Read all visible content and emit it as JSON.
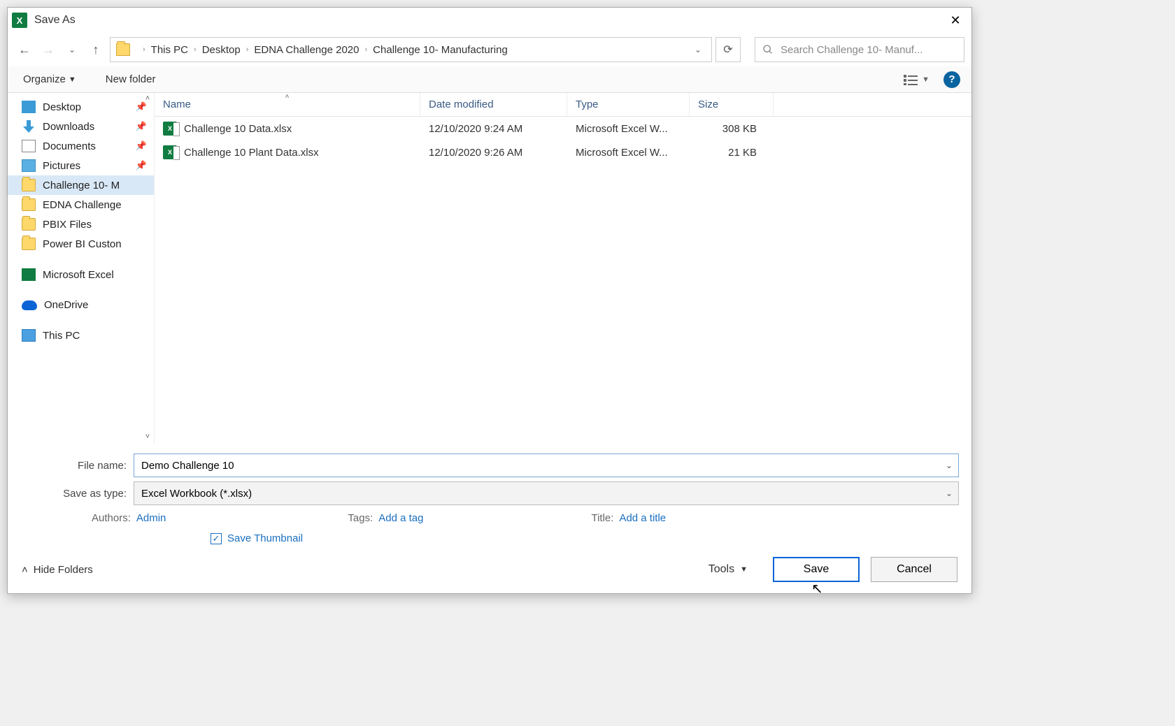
{
  "dialog": {
    "title": "Save As"
  },
  "nav": {
    "breadcrumb": [
      "This PC",
      "Desktop",
      "EDNA Challenge 2020",
      "Challenge 10- Manufacturing"
    ],
    "search_placeholder": "Search Challenge 10- Manuf..."
  },
  "toolbar": {
    "organize": "Organize",
    "newfolder": "New folder"
  },
  "sidebar": {
    "items": [
      {
        "label": "Desktop",
        "icon": "desktop",
        "pinned": true
      },
      {
        "label": "Downloads",
        "icon": "down",
        "pinned": true
      },
      {
        "label": "Documents",
        "icon": "doc",
        "pinned": true
      },
      {
        "label": "Pictures",
        "icon": "pic",
        "pinned": true
      },
      {
        "label": "Challenge 10- M",
        "icon": "folder",
        "selected": true
      },
      {
        "label": "EDNA Challenge",
        "icon": "folder"
      },
      {
        "label": "PBIX Files",
        "icon": "folder"
      },
      {
        "label": "Power BI Custon",
        "icon": "folder"
      },
      {
        "label": "Microsoft Excel",
        "icon": "excel",
        "gap": true
      },
      {
        "label": "OneDrive",
        "icon": "onedrive",
        "gap": true
      },
      {
        "label": "This PC",
        "icon": "pc",
        "gap": true
      }
    ]
  },
  "columns": {
    "name": "Name",
    "date": "Date modified",
    "type": "Type",
    "size": "Size"
  },
  "files": [
    {
      "name": "Challenge 10 Data.xlsx",
      "date": "12/10/2020 9:24 AM",
      "type": "Microsoft Excel W...",
      "size": "308 KB"
    },
    {
      "name": "Challenge 10 Plant Data.xlsx",
      "date": "12/10/2020 9:26 AM",
      "type": "Microsoft Excel W...",
      "size": "21 KB"
    }
  ],
  "fields": {
    "filename_label": "File name:",
    "filename_value": "Demo Challenge 10",
    "savetype_label": "Save as type:",
    "savetype_value": "Excel Workbook (*.xlsx)",
    "authors_label": "Authors:",
    "authors_value": "Admin",
    "tags_label": "Tags:",
    "tags_value": "Add a tag",
    "title_label": "Title:",
    "title_value": "Add a title",
    "thumb_label": "Save Thumbnail"
  },
  "footer": {
    "hide": "Hide Folders",
    "tools": "Tools",
    "save": "Save",
    "cancel": "Cancel"
  }
}
